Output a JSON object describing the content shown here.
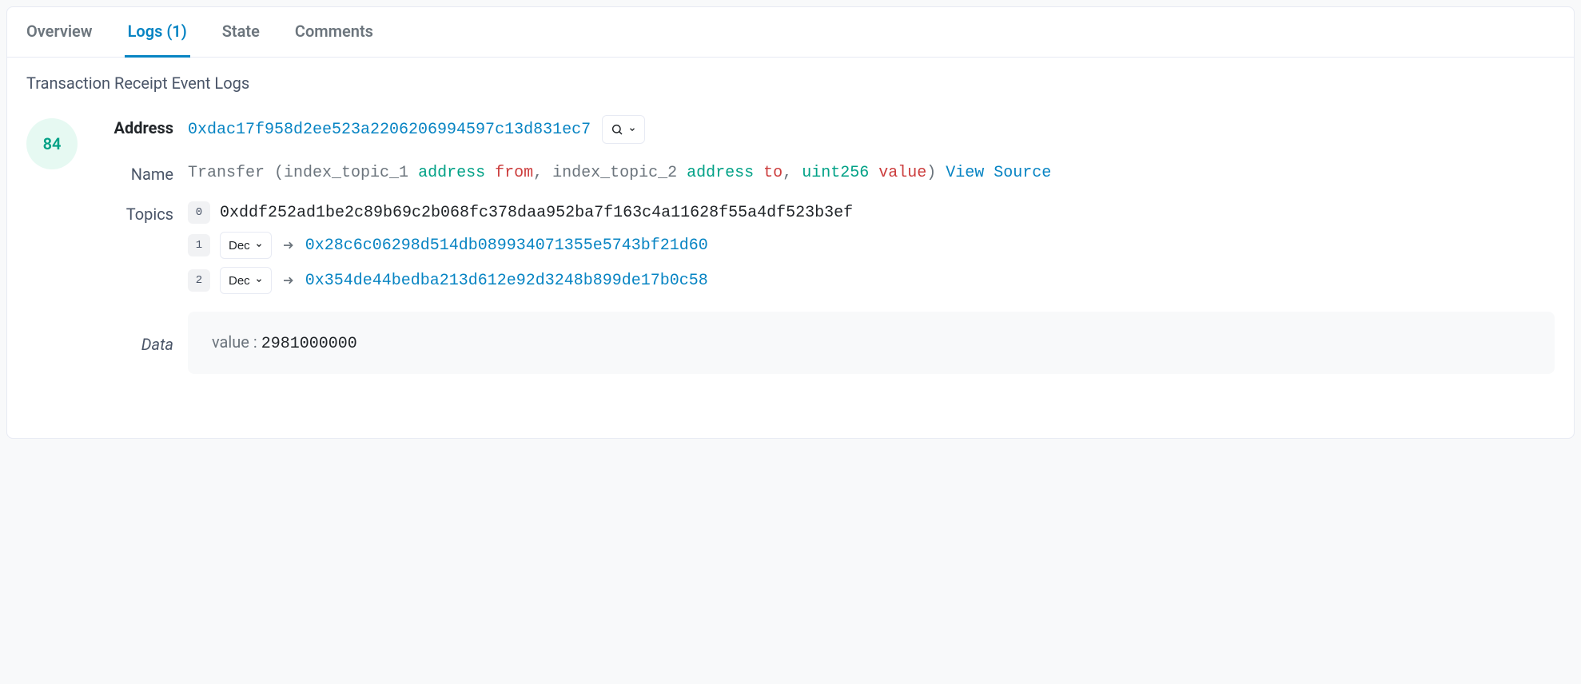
{
  "tabs": [
    {
      "label": "Overview"
    },
    {
      "label": "Logs (1)"
    },
    {
      "label": "State"
    },
    {
      "label": "Comments"
    }
  ],
  "section_title": "Transaction Receipt Event Logs",
  "log": {
    "index": "84",
    "labels": {
      "address": "Address",
      "name": "Name",
      "topics": "Topics",
      "data": "Data"
    },
    "address": "0xdac17f958d2ee523a2206206994597c13d831ec7",
    "event_name": {
      "fn": "Transfer",
      "parts": [
        {
          "text": "index_topic_1 ",
          "cls": "c-gray"
        },
        {
          "text": "address ",
          "cls": "c-green"
        },
        {
          "text": "from",
          "cls": "c-red"
        },
        {
          "text": ", ",
          "cls": "c-gray"
        },
        {
          "text": "index_topic_2 ",
          "cls": "c-gray"
        },
        {
          "text": "address ",
          "cls": "c-green"
        },
        {
          "text": "to",
          "cls": "c-red"
        },
        {
          "text": ", ",
          "cls": "c-gray"
        },
        {
          "text": "uint256 ",
          "cls": "c-green"
        },
        {
          "text": "value",
          "cls": "c-red"
        }
      ],
      "view_source": "View Source"
    },
    "topics": [
      {
        "idx": "0",
        "value": "0xddf252ad1be2c89b69c2b068fc378daa952ba7f163c4a11628f55a4df523b3ef",
        "decoded": false
      },
      {
        "idx": "1",
        "selector": "Dec",
        "value": "0x28c6c06298d514db089934071355e5743bf21d60",
        "decoded": true
      },
      {
        "idx": "2",
        "selector": "Dec",
        "value": "0x354de44bedba213d612e92d3248b899de17b0c58",
        "decoded": true
      }
    ],
    "data": {
      "key": "value",
      "value": "2981000000"
    }
  }
}
